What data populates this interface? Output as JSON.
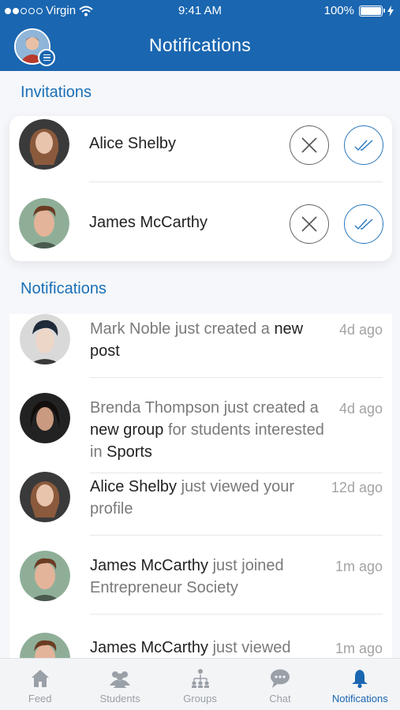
{
  "status_bar": {
    "carrier": "Virgin",
    "time": "9:41 AM",
    "battery": "100%"
  },
  "header": {
    "title": "Notifications"
  },
  "invitations": {
    "section_title": "Invitations",
    "items": [
      {
        "name": "Alice Shelby"
      },
      {
        "name": "James McCarthy"
      }
    ]
  },
  "notifications": {
    "section_title": "Notifications",
    "items": [
      {
        "parts": [
          {
            "t": "Mark Noble just created a ",
            "b": false
          },
          {
            "t": "new post",
            "b": true
          }
        ],
        "time": "4d ago"
      },
      {
        "parts": [
          {
            "t": "Brenda Thompson just created a ",
            "b": false
          },
          {
            "t": "new group",
            "b": true
          },
          {
            "t": " for students interested in ",
            "b": false
          },
          {
            "t": "Sports",
            "b": true
          }
        ],
        "time": "4d ago"
      },
      {
        "parts": [
          {
            "t": "Alice Shelby",
            "b": true
          },
          {
            "t": " just viewed your profile",
            "b": false
          }
        ],
        "time": "12d ago"
      },
      {
        "parts": [
          {
            "t": "James McCarthy",
            "b": true
          },
          {
            "t": " just joined Entrepreneur Society",
            "b": false
          }
        ],
        "time": "1m ago"
      },
      {
        "parts": [
          {
            "t": "James McCarthy",
            "b": true
          },
          {
            "t": " just viewed",
            "b": false
          }
        ],
        "time": "1m ago"
      }
    ]
  },
  "tabbar": {
    "items": [
      {
        "label": "Feed",
        "icon": "home-icon"
      },
      {
        "label": "Students",
        "icon": "students-icon"
      },
      {
        "label": "Groups",
        "icon": "groups-icon"
      },
      {
        "label": "Chat",
        "icon": "chat-icon"
      },
      {
        "label": "Notifications",
        "icon": "bell-icon",
        "active": true
      }
    ]
  },
  "colors": {
    "brand": "#1a66b0",
    "accent_text": "#1a6fb5"
  }
}
